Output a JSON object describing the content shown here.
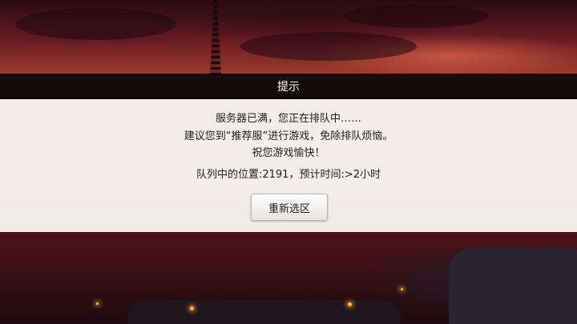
{
  "dialog": {
    "title": "提示",
    "message_lines": [
      "服务器已满，您正在排队中……",
      "建议您到“推荐服”进行游戏，免除排队烦恼。",
      "祝您游戏愉快！"
    ],
    "queue_info": "队列中的位置:2191，预计时间:>2小时",
    "reselect_button_label": "重新选区"
  },
  "colors": {
    "title_bar": "#0c080a",
    "dialog_body": "#f6f3f3",
    "text": "#1f1f1f",
    "ember": "#ffb43a"
  }
}
